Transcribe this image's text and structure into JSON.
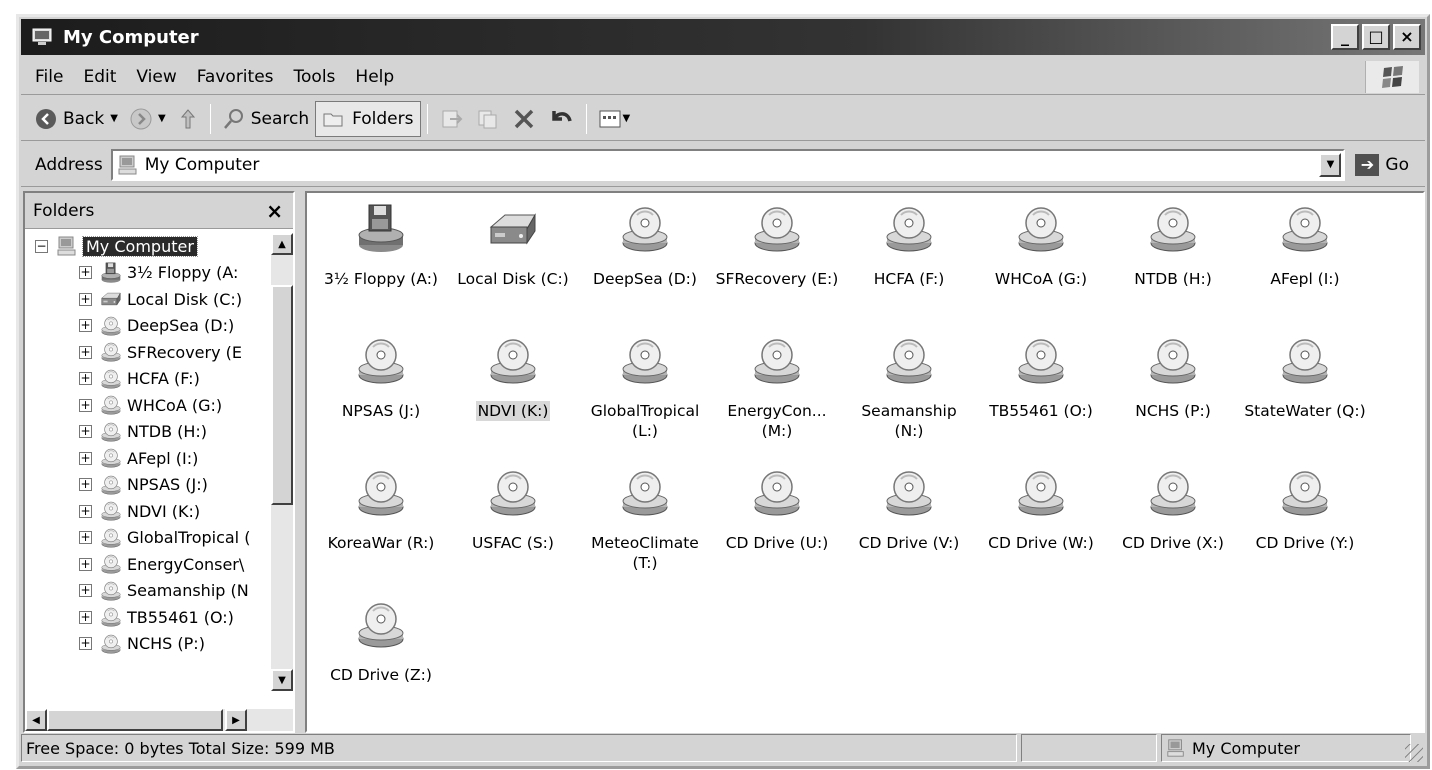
{
  "window": {
    "title": "My Computer",
    "buttons": [
      "_",
      "□",
      "×"
    ]
  },
  "menu": [
    "File",
    "Edit",
    "View",
    "Favorites",
    "Tools",
    "Help"
  ],
  "toolbar": {
    "back_label": "Back",
    "search_label": "Search",
    "folders_label": "Folders"
  },
  "address": {
    "label": "Address",
    "value": "My Computer",
    "go_label": "Go"
  },
  "folders_pane": {
    "title": "Folders",
    "close": "×",
    "tree": [
      {
        "label": "My Computer",
        "icon": "computer-icon",
        "root": true
      },
      {
        "label": "3½ Floppy (A:",
        "icon": "floppy-icon"
      },
      {
        "label": "Local Disk (C:)",
        "icon": "harddisk-icon"
      },
      {
        "label": "DeepSea (D:)",
        "icon": "cd-drive-icon"
      },
      {
        "label": "SFRecovery (E",
        "icon": "cd-drive-icon"
      },
      {
        "label": "HCFA (F:)",
        "icon": "cd-drive-icon"
      },
      {
        "label": "WHCoA (G:)",
        "icon": "cd-drive-icon"
      },
      {
        "label": "NTDB (H:)",
        "icon": "cd-drive-icon"
      },
      {
        "label": "AFepl (I:)",
        "icon": "cd-drive-icon"
      },
      {
        "label": "NPSAS (J:)",
        "icon": "cd-drive-icon"
      },
      {
        "label": "NDVI (K:)",
        "icon": "cd-drive-icon"
      },
      {
        "label": "GlobalTropical (",
        "icon": "cd-drive-icon"
      },
      {
        "label": "EnergyConser\\",
        "icon": "cd-drive-icon"
      },
      {
        "label": "Seamanship (N",
        "icon": "cd-drive-icon"
      },
      {
        "label": "TB55461 (O:)",
        "icon": "cd-drive-icon"
      },
      {
        "label": "NCHS (P:)",
        "icon": "cd-drive-icon"
      }
    ]
  },
  "drives": [
    {
      "label": "3½ Floppy (A:)",
      "icon": "floppy-icon"
    },
    {
      "label": "Local Disk (C:)",
      "icon": "harddisk-icon"
    },
    {
      "label": "DeepSea (D:)",
      "icon": "cd-drive-icon"
    },
    {
      "label": "SFRecovery (E:)",
      "icon": "cd-drive-icon"
    },
    {
      "label": "HCFA (F:)",
      "icon": "cd-drive-icon"
    },
    {
      "label": "WHCoA (G:)",
      "icon": "cd-drive-icon"
    },
    {
      "label": "NTDB (H:)",
      "icon": "cd-drive-icon"
    },
    {
      "label": "AFepl (I:)",
      "icon": "cd-drive-icon"
    },
    {
      "label": "NPSAS (J:)",
      "icon": "cd-drive-icon"
    },
    {
      "label": "NDVI (K:)",
      "icon": "cd-drive-icon",
      "selected": true
    },
    {
      "label": "GlobalTropical (L:)",
      "icon": "cd-drive-icon"
    },
    {
      "label": "EnergyCon... (M:)",
      "icon": "cd-drive-icon"
    },
    {
      "label": "Seamanship (N:)",
      "icon": "cd-drive-icon"
    },
    {
      "label": "TB55461 (O:)",
      "icon": "cd-drive-icon"
    },
    {
      "label": "NCHS (P:)",
      "icon": "cd-drive-icon"
    },
    {
      "label": "StateWater (Q:)",
      "icon": "cd-drive-icon"
    },
    {
      "label": "KoreaWar (R:)",
      "icon": "cd-drive-icon"
    },
    {
      "label": "USFAC (S:)",
      "icon": "cd-drive-icon"
    },
    {
      "label": "MeteoClimate (T:)",
      "icon": "cd-drive-icon"
    },
    {
      "label": "CD Drive (U:)",
      "icon": "cd-drive-icon"
    },
    {
      "label": "CD Drive (V:)",
      "icon": "cd-drive-icon"
    },
    {
      "label": "CD Drive (W:)",
      "icon": "cd-drive-icon"
    },
    {
      "label": "CD Drive (X:)",
      "icon": "cd-drive-icon"
    },
    {
      "label": "CD Drive (Y:)",
      "icon": "cd-drive-icon"
    },
    {
      "label": "CD Drive (Z:)",
      "icon": "cd-drive-icon"
    }
  ],
  "status": {
    "left": "Free Space: 0 bytes Total Size: 599 MB",
    "right": "My Computer"
  }
}
